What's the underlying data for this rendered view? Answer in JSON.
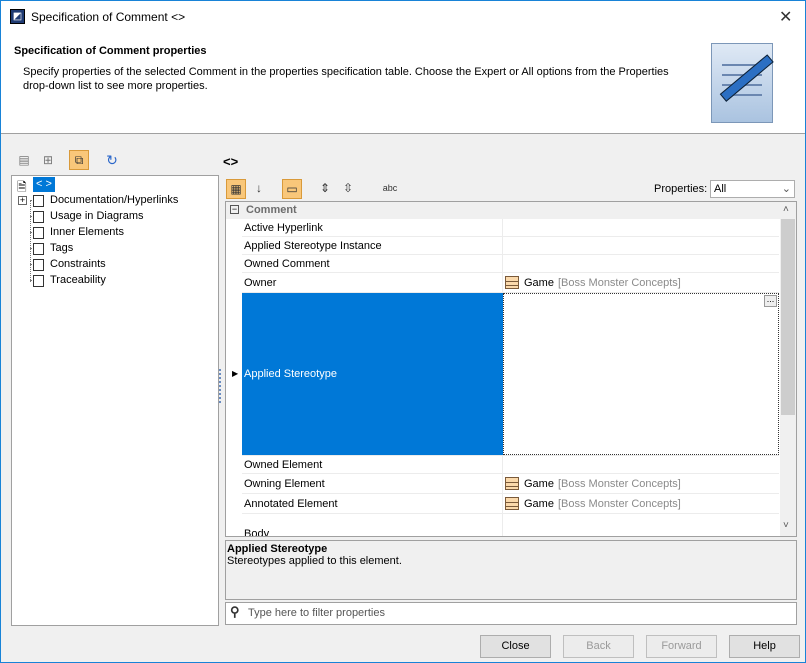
{
  "window": {
    "title": "Specification of Comment <>",
    "close": "✕"
  },
  "header": {
    "title": "Specification of Comment properties",
    "description": "Specify properties of the selected Comment in the properties specification table. Choose the Expert or All options from the Properties drop-down list to see more properties."
  },
  "tree": {
    "root": "< >",
    "items": [
      "Documentation/Hyperlinks",
      "Usage in Diagrams",
      "Inner Elements",
      "Tags",
      "Constraints",
      "Traceability"
    ]
  },
  "breadcrumb": "<>",
  "properties": {
    "label": "Properties:",
    "selected": "All"
  },
  "grid": {
    "group": "Comment",
    "rows": [
      {
        "name": "Active Hyperlink",
        "value": "",
        "owner": ""
      },
      {
        "name": "Applied Stereotype Instance",
        "value": "",
        "owner": ""
      },
      {
        "name": "Owned Comment",
        "value": "",
        "owner": ""
      },
      {
        "name": "Owner",
        "value": "Game",
        "owner": "[Boss Monster Concepts]"
      },
      {
        "name": "Applied Stereotype",
        "value": "",
        "owner": ""
      },
      {
        "name": "Owned Element",
        "value": "",
        "owner": ""
      },
      {
        "name": "Owning Element",
        "value": "Game",
        "owner": "[Boss Monster Concepts]"
      },
      {
        "name": "Annotated Element",
        "value": "Game",
        "owner": "[Boss Monster Concepts]"
      },
      {
        "name": "Body",
        "value": "",
        "owner": ""
      }
    ],
    "ellipsis": "..."
  },
  "description": {
    "title": "Applied Stereotype",
    "text": "Stereotypes applied to this element."
  },
  "filter": {
    "placeholder": "Type here to filter properties"
  },
  "buttons": {
    "close": "Close",
    "back": "Back",
    "forward": "Forward",
    "help": "Help"
  }
}
